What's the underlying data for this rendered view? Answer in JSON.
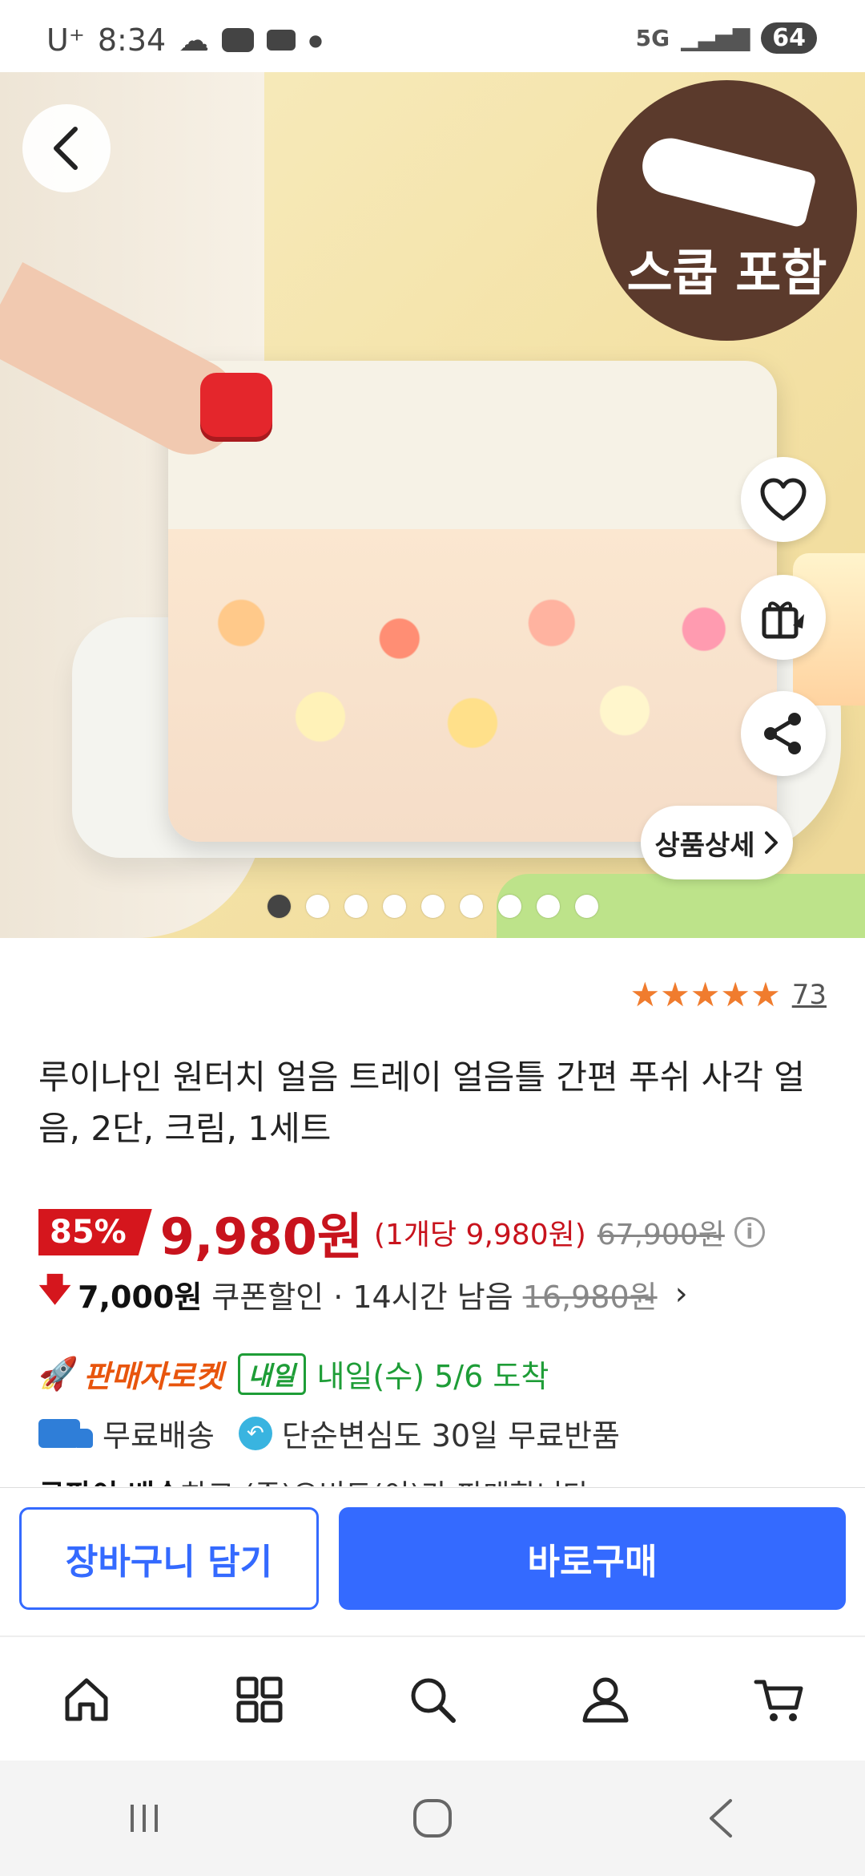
{
  "status_bar": {
    "carrier": "U⁺",
    "time": "8:34",
    "network": "5G",
    "battery": "64"
  },
  "hero": {
    "badge_text": "스쿱 포함",
    "detail_label": "상품상세",
    "carousel_total": 9,
    "carousel_active": 1
  },
  "product": {
    "rating_stars": 5,
    "review_count": "73",
    "title": "루이나인 원터치 얼음 트레이 얼음틀 간편 푸쉬 사각 얼음, 2단, 크림, 1세트",
    "discount": "85%",
    "price": "9,980원",
    "unit_price": "(1개당 9,980원)",
    "original_price": "67,900원",
    "coupon_amount": "7,000원",
    "coupon_text": "쿠폰할인 · 14시간 남음",
    "coupon_old_price": "16,980원",
    "rocket_label": "판매자로켓",
    "tomorrow_badge": "내일",
    "arrival_text": "내일(수) 5/6 도착",
    "shipping_text": "무료배송",
    "return_text": "단순변심도 30일 무료반품",
    "seller_bold": "쿠팡이 배송",
    "seller_text": "하고 (주)오비드(이)가 판매합니다"
  },
  "actions": {
    "add_to_cart": "장바구니 담기",
    "buy_now": "바로구매"
  },
  "colors": {
    "accent_blue": "#346aff",
    "price_red": "#c8131d",
    "rocket_orange": "#e8550d",
    "delivery_green": "#1e9d37",
    "badge_brown": "#5b3a2c"
  }
}
